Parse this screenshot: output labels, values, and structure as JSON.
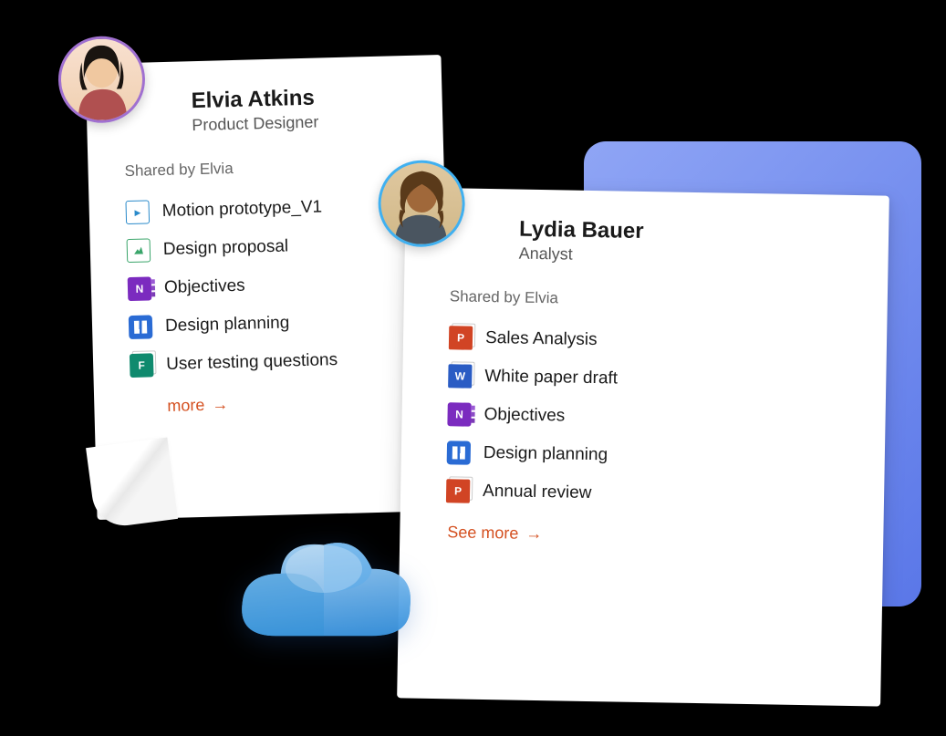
{
  "cards": [
    {
      "name": "Elvia Atkins",
      "role": "Product Designer",
      "avatar_ring": "#a070d0",
      "shared_label": "Shared by Elvia",
      "see_more": "more",
      "see_more_cut": true,
      "files": [
        {
          "icon": "video",
          "label": "Motion prototype_V1"
        },
        {
          "icon": "image",
          "label": "Design proposal"
        },
        {
          "icon": "onenote",
          "label": "Objectives"
        },
        {
          "icon": "trello",
          "label": "Design planning"
        },
        {
          "icon": "forms",
          "label": "User testing questions"
        }
      ]
    },
    {
      "name": "Lydia Bauer",
      "role": "Analyst",
      "avatar_ring": "#40b0f0",
      "shared_label": "Shared by Elvia",
      "see_more": "See more",
      "see_more_cut": false,
      "files": [
        {
          "icon": "ppt",
          "label": "Sales Analysis"
        },
        {
          "icon": "word",
          "label": "White paper draft"
        },
        {
          "icon": "onenote",
          "label": "Objectives"
        },
        {
          "icon": "trello",
          "label": "Design planning"
        },
        {
          "icon": "ppt",
          "label": "Annual review"
        }
      ]
    }
  ],
  "colors": {
    "accent_orange": "#d45020",
    "bg_gradient_start": "#8fa5f5",
    "bg_gradient_end": "#5a77e8"
  }
}
